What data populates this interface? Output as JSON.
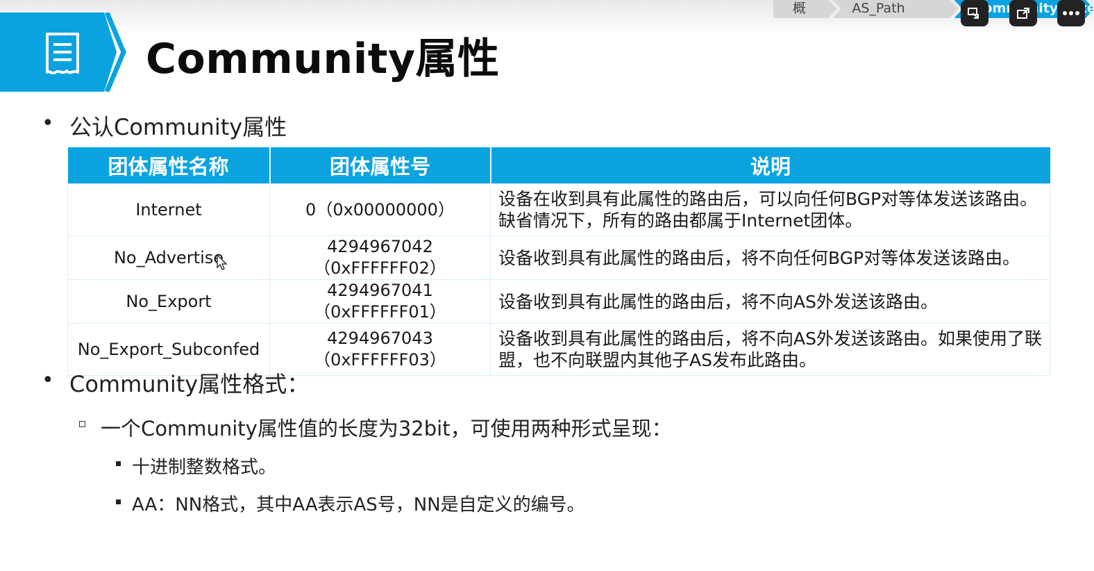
{
  "breadcrumbs": [
    "概述",
    "AS_Path Filter",
    "Community Filter"
  ],
  "header": {
    "title": "Community属性"
  },
  "section1": {
    "heading": "公认Community属性",
    "table": {
      "headers": [
        "团体属性名称",
        "团体属性号",
        "说明"
      ],
      "rows": [
        {
          "name": "Internet",
          "number": "0（0x00000000）",
          "desc": "设备在收到具有此属性的路由后，可以向任何BGP对等体发送该路由。缺省情况下，所有的路由都属于Internet团体。"
        },
        {
          "name": "No_Advertise",
          "number": "4294967042（0xFFFFFF02）",
          "desc": "设备收到具有此属性的路由后，将不向任何BGP对等体发送该路由。"
        },
        {
          "name": "No_Export",
          "number": "4294967041（0xFFFFFF01）",
          "desc": "设备收到具有此属性的路由后，将不向AS外发送该路由。"
        },
        {
          "name": "No_Export_Subconfed",
          "number": "4294967043（0xFFFFFF03）",
          "desc": "设备收到具有此属性的路由后，将不向AS外发送该路由。如果使用了联盟，也不向联盟内其他子AS发布此路由。"
        }
      ]
    }
  },
  "section2": {
    "heading": "Community属性格式：",
    "sub": "一个Community属性值的长度为32bit，可使用两种形式呈现：",
    "items": [
      "十进制整数格式。",
      "AA：NN格式，其中AA表示AS号，NN是自定义的编号。"
    ]
  },
  "bullet_char": "•",
  "colors": {
    "accent": "#0aa3e0",
    "control_bg": "#222222"
  },
  "icons": [
    "document-icon",
    "picture-in-picture-icon",
    "popout-icon",
    "more-icon"
  ]
}
